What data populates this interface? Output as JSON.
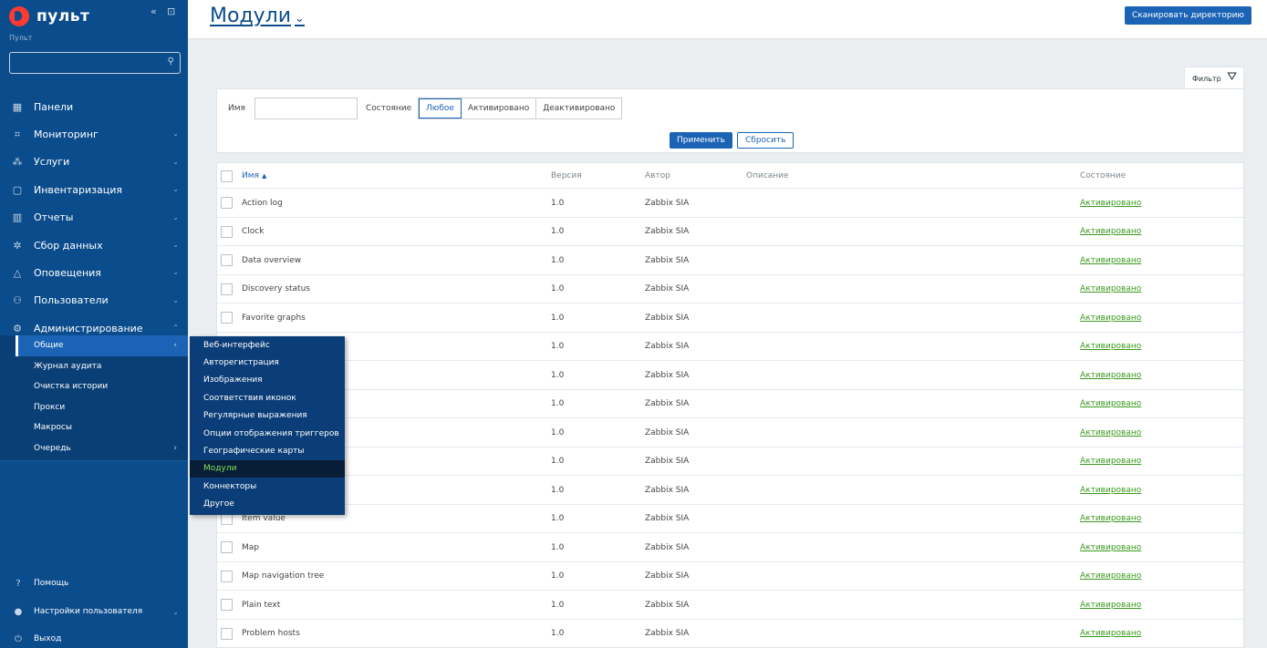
{
  "sidebar": {
    "brand": "пульт",
    "subtitle": "Пульт",
    "search_placeholder": "",
    "menu": [
      {
        "label": "Панели",
        "icon": "dashboard-icon",
        "chevron": ""
      },
      {
        "label": "Мониторинг",
        "icon": "monitoring-icon",
        "chevron": "⌄"
      },
      {
        "label": "Услуги",
        "icon": "services-icon",
        "chevron": "⌄"
      },
      {
        "label": "Инвентаризация",
        "icon": "inventory-icon",
        "chevron": "⌄"
      },
      {
        "label": "Отчеты",
        "icon": "reports-icon",
        "chevron": "⌄"
      },
      {
        "label": "Сбор данных",
        "icon": "data-collection-icon",
        "chevron": "⌄"
      },
      {
        "label": "Оповещения",
        "icon": "bell-icon",
        "chevron": "⌄"
      },
      {
        "label": "Пользователи",
        "icon": "users-icon",
        "chevron": "⌄"
      },
      {
        "label": "Администрирование",
        "icon": "gear-icon",
        "chevron": "⌃"
      }
    ],
    "submenu": [
      {
        "label": "Общие",
        "chevron": "‹"
      },
      {
        "label": "Журнал аудита",
        "chevron": ""
      },
      {
        "label": "Очистка истории",
        "chevron": ""
      },
      {
        "label": "Прокси",
        "chevron": ""
      },
      {
        "label": "Макросы",
        "chevron": ""
      },
      {
        "label": "Очередь",
        "chevron": "›"
      }
    ],
    "bottom": {
      "help": "Помощь",
      "user_settings": "Настройки пользователя",
      "logout": "Выход"
    }
  },
  "flyout": {
    "items": [
      "Веб-интерфейс",
      "Авторегистрация",
      "Изображения",
      "Соответствия иконок",
      "Регулярные выражения",
      "Опции отображения триггеров",
      "Географические карты",
      "Модули",
      "Коннекторы",
      "Другое"
    ],
    "active_index": 7
  },
  "header": {
    "title": "Модули",
    "scan_button": "Сканировать директорию"
  },
  "filter": {
    "tab_label": "Фильтр",
    "name_label": "Имя",
    "name_value": "",
    "state_label": "Состояние",
    "state_options": [
      "Любое",
      "Активировано",
      "Деактивировано"
    ],
    "state_selected": 0,
    "apply": "Применить",
    "reset": "Сбросить"
  },
  "table": {
    "columns": {
      "name": "Имя",
      "version": "Версия",
      "author": "Автор",
      "description": "Описание",
      "state": "Состояние"
    },
    "rows": [
      {
        "name": "Action log",
        "version": "1.0",
        "author": "Zabbix SIA",
        "description": "",
        "state": "Активировано"
      },
      {
        "name": "Clock",
        "version": "1.0",
        "author": "Zabbix SIA",
        "description": "",
        "state": "Активировано"
      },
      {
        "name": "Data overview",
        "version": "1.0",
        "author": "Zabbix SIA",
        "description": "",
        "state": "Активировано"
      },
      {
        "name": "Discovery status",
        "version": "1.0",
        "author": "Zabbix SIA",
        "description": "",
        "state": "Активировано"
      },
      {
        "name": "Favorite graphs",
        "version": "1.0",
        "author": "Zabbix SIA",
        "description": "",
        "state": "Активировано"
      },
      {
        "name": "",
        "version": "1.0",
        "author": "Zabbix SIA",
        "description": "",
        "state": "Активировано"
      },
      {
        "name": "",
        "version": "1.0",
        "author": "Zabbix SIA",
        "description": "",
        "state": "Активировано"
      },
      {
        "name": "",
        "version": "1.0",
        "author": "Zabbix SIA",
        "description": "",
        "state": "Активировано"
      },
      {
        "name": "",
        "version": "1.0",
        "author": "Zabbix SIA",
        "description": "",
        "state": "Активировано"
      },
      {
        "name": "",
        "version": "1.0",
        "author": "Zabbix SIA",
        "description": "",
        "state": "Активировано"
      },
      {
        "name": "",
        "version": "1.0",
        "author": "Zabbix SIA",
        "description": "",
        "state": "Активировано"
      },
      {
        "name": "Item value",
        "version": "1.0",
        "author": "Zabbix SIA",
        "description": "",
        "state": "Активировано"
      },
      {
        "name": "Map",
        "version": "1.0",
        "author": "Zabbix SIA",
        "description": "",
        "state": "Активировано"
      },
      {
        "name": "Map navigation tree",
        "version": "1.0",
        "author": "Zabbix SIA",
        "description": "",
        "state": "Активировано"
      },
      {
        "name": "Plain text",
        "version": "1.0",
        "author": "Zabbix SIA",
        "description": "",
        "state": "Активировано"
      },
      {
        "name": "Problem hosts",
        "version": "1.0",
        "author": "Zabbix SIA",
        "description": "",
        "state": "Активировано"
      }
    ]
  },
  "colors": {
    "sidebar_bg": "#0b4c8c",
    "accent": "#1b63b5",
    "active_green": "#3b9a1e",
    "brand_red": "#ff3b30"
  }
}
